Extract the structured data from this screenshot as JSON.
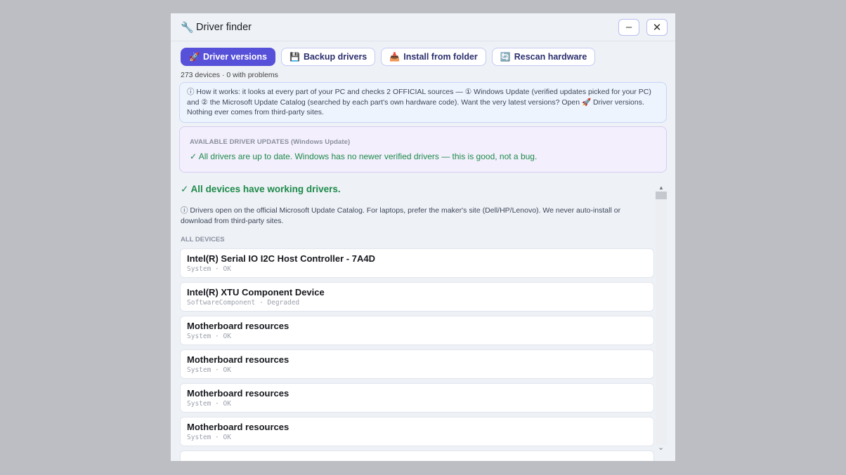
{
  "window": {
    "title": "Driver finder",
    "title_icon": "wrench-icon",
    "minimize_label": "–",
    "close_label": "✕"
  },
  "toolbar": {
    "buttons": [
      {
        "label": "Driver versions",
        "icon": "rocket-icon",
        "glyph": "🚀",
        "active": true
      },
      {
        "label": "Backup drivers",
        "icon": "save-icon",
        "glyph": "💾",
        "active": false
      },
      {
        "label": "Install from folder",
        "icon": "install-icon",
        "glyph": "📥",
        "active": false
      },
      {
        "label": "Rescan hardware",
        "icon": "rescan-icon",
        "glyph": "🔄",
        "active": false
      }
    ]
  },
  "summary": "273 devices · 0 with problems",
  "info": {
    "text": "ⓘ How it works: it looks at every part of your PC and checks 2 OFFICIAL sources — ① Windows Update (verified updates picked for your PC) and ② the Microsoft Update Catalog (searched by each part's own hardware code). Want the very latest versions? Open 🚀 Driver versions. Nothing ever comes from third-party sites."
  },
  "updates": {
    "title": "AVAILABLE DRIVER UPDATES (Windows Update)",
    "message": "✓ All drivers are up to date. Windows has no newer verified drivers — this is good, not a bug."
  },
  "status": {
    "heading": "✓ All devices have working drivers.",
    "note": "ⓘ Drivers open on the official Microsoft Update Catalog. For laptops, prefer the maker's site (Dell/HP/Lenovo). We never auto-install or download from third-party sites."
  },
  "devices": {
    "section_title": "ALL DEVICES",
    "items": [
      {
        "name": "Intel(R) Serial IO I2C Host Controller - 7A4D",
        "sub": "System · OK"
      },
      {
        "name": "Intel(R) XTU Component Device",
        "sub": "SoftwareComponent · Degraded"
      },
      {
        "name": "Motherboard resources",
        "sub": "System · OK"
      },
      {
        "name": "Motherboard resources",
        "sub": "System · OK"
      },
      {
        "name": "Motherboard resources",
        "sub": "System · OK"
      },
      {
        "name": "Motherboard resources",
        "sub": "System · OK"
      }
    ]
  },
  "colors": {
    "accent": "#5750d9",
    "success": "#1e8a4a",
    "window_bg": "#eef1f6"
  }
}
